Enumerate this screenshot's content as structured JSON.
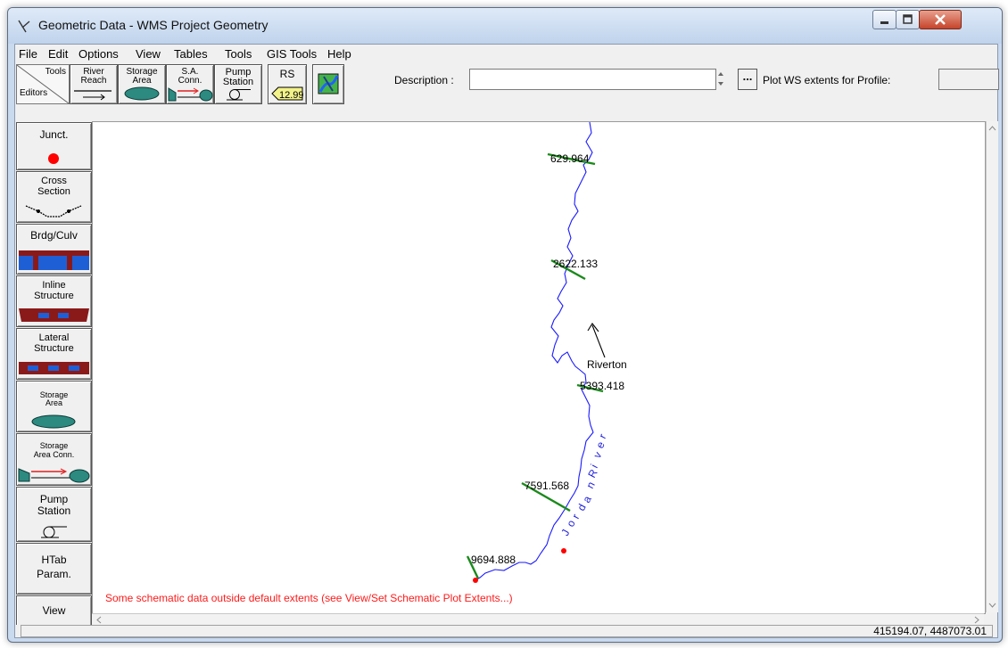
{
  "window": {
    "title": "Geometric Data - WMS Project Geometry"
  },
  "menu": {
    "items": [
      "File",
      "Edit",
      "Options",
      "View",
      "Tables",
      "Tools",
      "GIS Tools",
      "Help"
    ]
  },
  "toolbar": {
    "tools_label": "Tools",
    "editors_label": "Editors",
    "river_reach": [
      "River",
      "Reach"
    ],
    "storage_area": [
      "Storage",
      "Area"
    ],
    "sa_conn": [
      "S.A.",
      "Conn."
    ],
    "pump_station": [
      "Pump",
      "Station"
    ],
    "rs": {
      "label": "RS",
      "tag": "12.99"
    },
    "description_label": "Description :",
    "description_value": "",
    "ellipsis": "...",
    "plot_ws_label": "Plot WS extents for Profile:",
    "profile_value": ""
  },
  "sidebar": {
    "junct": "Junct.",
    "cross_section": [
      "Cross",
      "Section"
    ],
    "brdg_culv": "Brdg/Culv",
    "inline_structure": [
      "Inline",
      "Structure"
    ],
    "lateral_structure": [
      "Lateral",
      "Structure"
    ],
    "storage_area": [
      "Storage",
      "Area"
    ],
    "storage_area_conn": [
      "Storage",
      "Area Conn."
    ],
    "pump_station": [
      "Pump",
      "Station"
    ],
    "htab_param": [
      "HTab",
      "Param."
    ],
    "view": "View"
  },
  "canvas": {
    "cross_sections": [
      "629.964",
      "2622.133",
      "5393.418",
      "7591.568",
      "9694.888"
    ],
    "junction_label": "Riverton",
    "river_name_chars": [
      "J",
      "o",
      "r",
      "d",
      "a",
      "n",
      "R",
      "i",
      "v",
      "e",
      "r"
    ],
    "message": "Some schematic data outside default extents (see View/Set Schematic Plot Extents...)"
  },
  "status": {
    "coordinates": "415194.07, 4487073.01"
  },
  "colors": {
    "junction": "#ff0000",
    "river": "#1a1aff",
    "xs_line": "#1a8a1a",
    "message": "#ff1a1a"
  }
}
